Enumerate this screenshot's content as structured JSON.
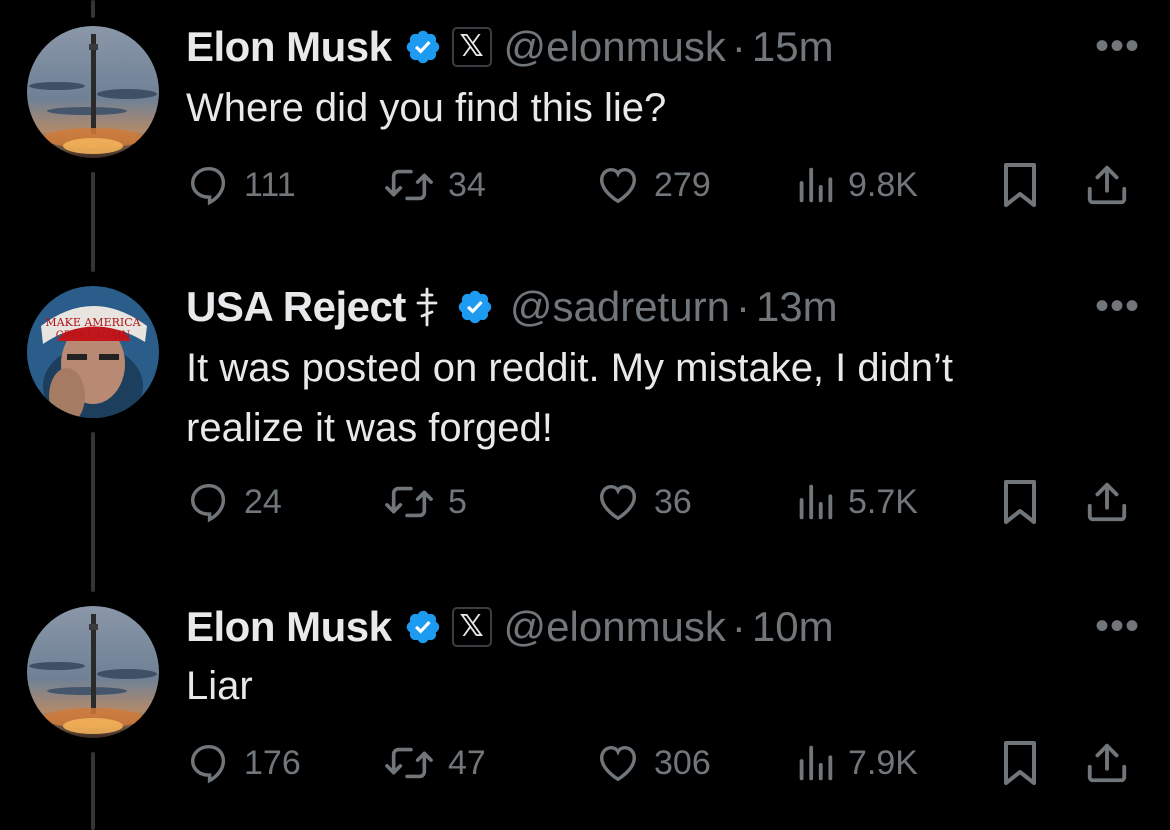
{
  "tweets": [
    {
      "name": "Elon Musk",
      "handle": "@elonmusk",
      "separator": "·",
      "time": "15m",
      "text": "Where did you find this lie?",
      "x_badge": "𝕏",
      "replies": "111",
      "reposts": "34",
      "likes": "279",
      "views": "9.8K",
      "more": "•••"
    },
    {
      "name": "USA Reject",
      "handle": "@sadreturn",
      "separator": "·",
      "time": "13m",
      "text": "It was posted on reddit. My mistake, I didn’t realize it was forged!",
      "avatar_hat_text": "MAKE AMERICA GREAT AGAIN",
      "replies": "24",
      "reposts": "5",
      "likes": "36",
      "views": "5.7K",
      "more": "•••"
    },
    {
      "name": "Elon Musk",
      "handle": "@elonmusk",
      "separator": "·",
      "time": "10m",
      "text": "Liar",
      "x_badge": "𝕏",
      "replies": "176",
      "reposts": "47",
      "likes": "306",
      "views": "7.9K",
      "more": "•••"
    }
  ],
  "colors": {
    "background": "#000000",
    "text_primary": "#e7e9ea",
    "text_secondary": "#71767b",
    "verified_blue": "#1d9bf0",
    "thread_line": "#333639"
  },
  "icons": [
    "reply-icon",
    "repost-icon",
    "like-icon",
    "views-icon",
    "bookmark-icon",
    "share-icon",
    "verified-badge-icon",
    "more-icon"
  ]
}
